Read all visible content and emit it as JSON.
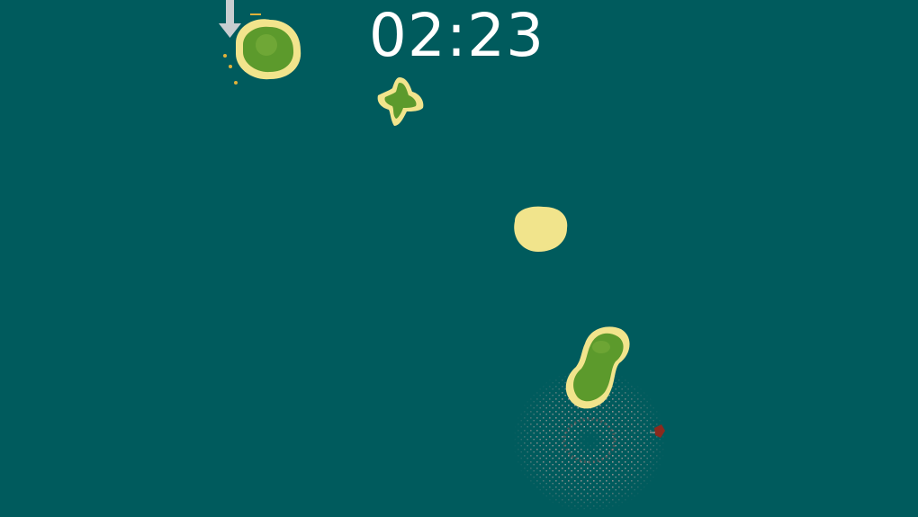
{
  "hud": {
    "timer": "02:23"
  },
  "colors": {
    "ocean": "#005b5d",
    "sand": "#f1e48c",
    "grass": "#5c9a2c",
    "grass_light": "#78ad3a",
    "wake": "#c9a7a4",
    "boat": "#8b2a1e",
    "arrow": "#c8cdd0"
  },
  "objects": {
    "islands": [
      {
        "name": "island-northwest",
        "type": "grass-island"
      },
      {
        "name": "island-star",
        "type": "grass-island"
      },
      {
        "name": "sandbar",
        "type": "sand-island"
      },
      {
        "name": "island-peanut",
        "type": "grass-island"
      }
    ],
    "indicator_icon": "down-arrow-icon",
    "player_icon": "boat-icon",
    "effect": "whirlpool-wake"
  }
}
